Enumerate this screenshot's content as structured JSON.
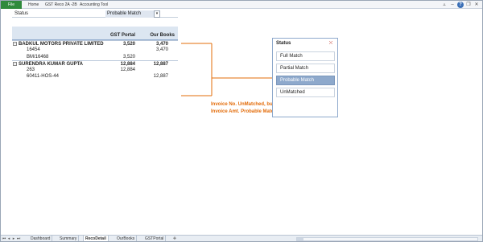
{
  "ribbon": {
    "file_tab": "File",
    "tabs": [
      "Home",
      "GST Reco 2A -2B",
      "Accounting Tool"
    ],
    "controls": [
      "caret-up-icon",
      "minimize-icon",
      "help-icon",
      "restore-icon",
      "close-icon"
    ]
  },
  "filter_row": {
    "label": "Status",
    "value": "Probable Match",
    "button_icon": "filter-dropdown-icon"
  },
  "pivot": {
    "headers": [
      "GST Portal",
      "Our Books"
    ],
    "rows": [
      {
        "name": "BADKUL MOTORS PRIVATE LIMITED",
        "gst_portal": "3,520",
        "our_books": "3,470",
        "group": true
      },
      {
        "name": "16454",
        "gst_portal": "",
        "our_books": "3,470",
        "group": false
      },
      {
        "name": "BM/16468",
        "gst_portal": "3,520",
        "our_books": "",
        "group": false
      },
      {
        "name": "SURENDRA KUMAR GUPTA",
        "gst_portal": "12,884",
        "our_books": "12,887",
        "group": true
      },
      {
        "name": "263",
        "gst_portal": "12,884",
        "our_books": "",
        "group": false
      },
      {
        "name": "60411-HOS-44",
        "gst_portal": "",
        "our_books": "12,887",
        "group": false
      }
    ]
  },
  "annotation": {
    "line1": "Invoice No. UnMatched, but",
    "line2": "Invoice Amt. Probable Match."
  },
  "slicer": {
    "title": "Status",
    "items": [
      "Full Match",
      "Partial Match",
      "Probable Match",
      "UnMatched"
    ],
    "selected": "Probable Match"
  },
  "sheet_tabs": {
    "tabs": [
      "Dashboard",
      "Summary",
      "RecoDetail",
      "OurBooks",
      "GSTPortal"
    ],
    "active": "RecoDetail"
  },
  "colors": {
    "accent_orange": "#e36c0a",
    "file_tab_green": "#2f8a3c",
    "pivot_header": "#dce6f1",
    "slicer_selected": "#8ea9cc"
  }
}
